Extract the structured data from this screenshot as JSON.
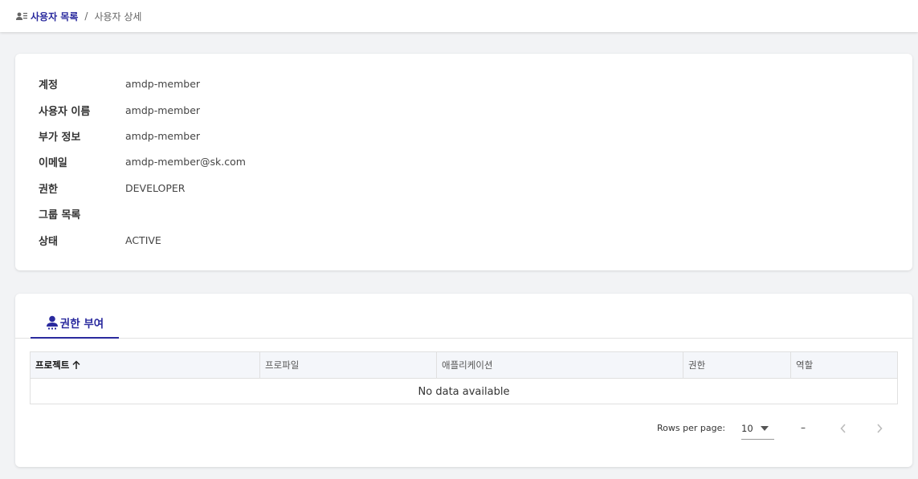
{
  "breadcrumb": {
    "parent": "사용자 목록",
    "separator": "/",
    "current": "사용자 상세"
  },
  "user": {
    "rows": [
      {
        "label": "계정",
        "value": "amdp-member"
      },
      {
        "label": "사용자 이름",
        "value": "amdp-member"
      },
      {
        "label": "부가 정보",
        "value": "amdp-member"
      },
      {
        "label": "이메일",
        "value": "amdp-member@sk.com"
      },
      {
        "label": "권한",
        "value": "DEVELOPER"
      },
      {
        "label": "그룹 목록",
        "value": ""
      },
      {
        "label": "상태",
        "value": "ACTIVE"
      }
    ]
  },
  "permissions": {
    "tab_label": "권한 부여",
    "columns": [
      "프로젝트",
      "프로파일",
      "애플리케이션",
      "권한",
      "역할"
    ],
    "empty_text": "No data available",
    "footer": {
      "rows_per_page_label": "Rows per page:",
      "rows_per_page_value": "10",
      "range": "–"
    }
  },
  "colors": {
    "accent": "#2a2a9e",
    "background": "#f2f3f5",
    "header_bg": "#f4f6fa"
  },
  "icons": {
    "breadcrumb": "user-list-icon",
    "tab": "user-permission-icon",
    "sort": "arrow-up-icon",
    "dropdown": "caret-down-icon",
    "prev": "chevron-left-icon",
    "next": "chevron-right-icon"
  }
}
